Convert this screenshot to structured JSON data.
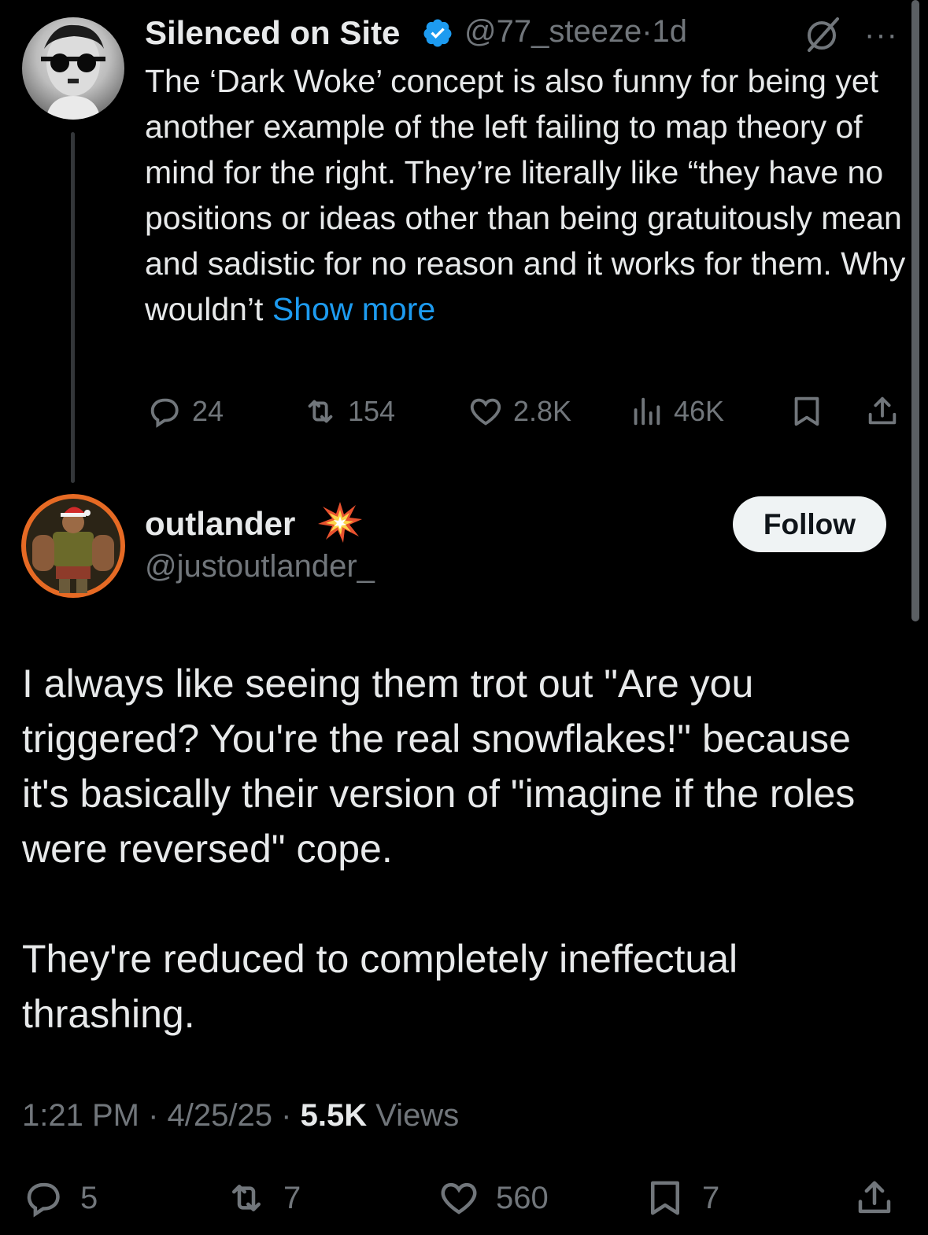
{
  "parent_tweet": {
    "author_name": "Silenced on Site",
    "handle": "@77_steeze",
    "separator": "·",
    "time_ago": "1d",
    "text": "The ‘Dark Woke’ concept is also funny for being yet another example of the left failing to map theory of mind for the right. They’re literally like “they have no positions or ideas other than being gratuitously mean and sadistic for no reason and it works for them. Why wouldn’t ",
    "show_more_label": "Show more",
    "more_label": "···",
    "replies": "24",
    "reposts": "154",
    "likes": "2.8K",
    "views": "46K"
  },
  "main_tweet": {
    "author_name": "outlander",
    "handle": "@justoutlander_",
    "follow_label": "Follow",
    "paragraphs": [
      "I always like seeing them trot out \"Are you triggered? You're the real snowflakes!\" because it's basically their version of \"imagine if the roles were reversed\" cope.",
      "They're reduced to completely ineffectual thrashing."
    ],
    "time": "1:21 PM",
    "date": "4/25/25",
    "dot": "·",
    "views_count": "5.5K",
    "views_label": "Views",
    "replies": "5",
    "reposts": "7",
    "likes": "560",
    "bookmarks": "7"
  },
  "colors": {
    "background": "#000000",
    "text": "#e7e9ea",
    "secondary": "#71767b",
    "link": "#1d9bf0",
    "verified": "#1d9bf0",
    "avatar_ring": "#e66a24"
  },
  "icons": [
    "verified-badge-icon",
    "grok-icon",
    "reply-icon",
    "repost-icon",
    "like-icon",
    "views-icon",
    "bookmark-icon",
    "share-icon",
    "explosion-emoji-icon"
  ]
}
